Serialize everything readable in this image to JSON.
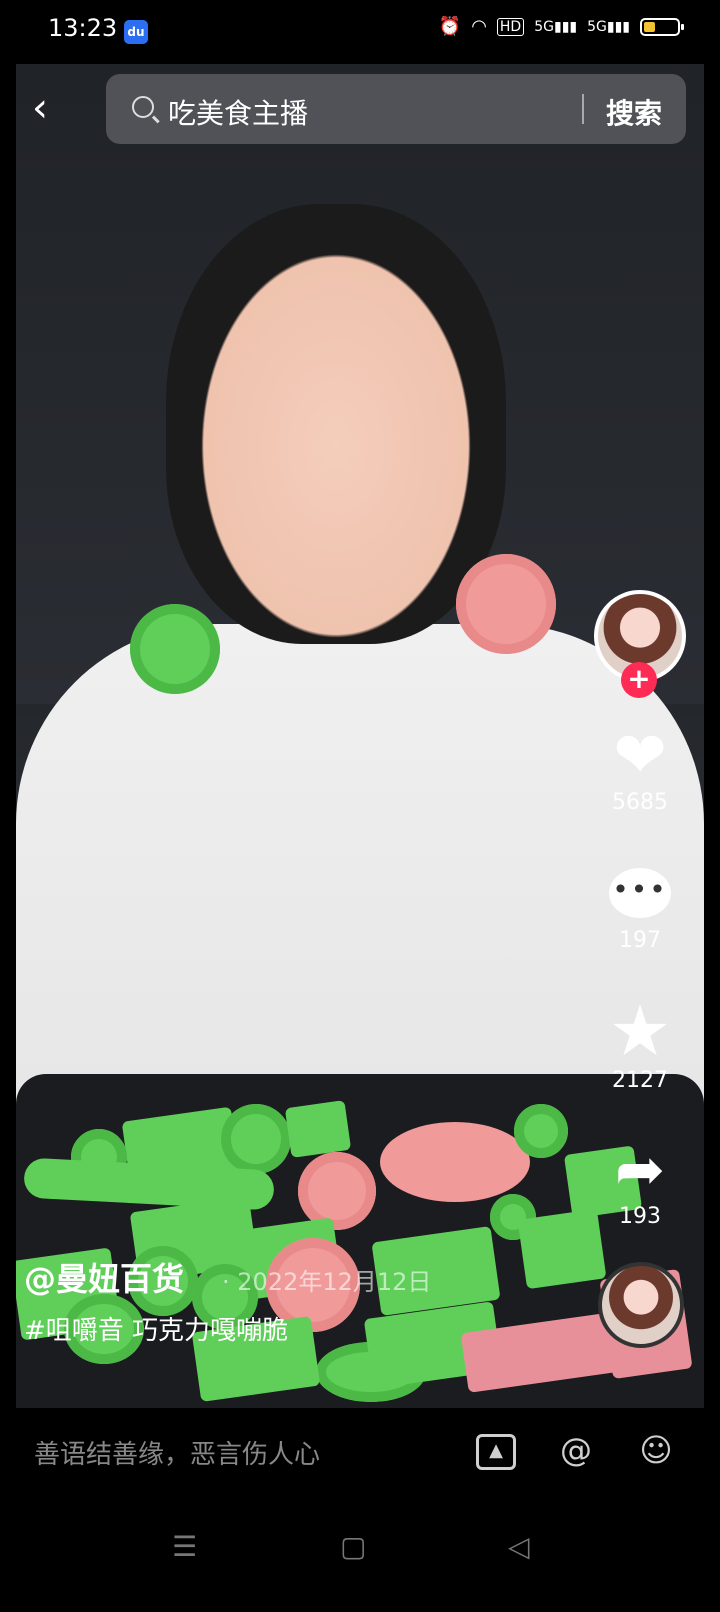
{
  "status_bar": {
    "time": "13:23",
    "app_badge": "du",
    "hd_label": "HD",
    "signal1": "5G",
    "signal2": "5G",
    "battery_level": 0.35
  },
  "search": {
    "query": "吃美食主播",
    "button_label": "搜索"
  },
  "rail": {
    "likes": "5685",
    "comments": "197",
    "favorites": "2127",
    "shares": "193"
  },
  "caption": {
    "author": "@曼妞百货",
    "date": "2022年12月12日",
    "description": "#咀嚼音 巧克力嘎嘣脆"
  },
  "comment_bar": {
    "placeholder": "善语结善缘，恶言伤人心"
  },
  "icons": {
    "back": "chevron-left-icon",
    "search": "search-icon",
    "like": "heart-icon",
    "comment": "comment-icon",
    "favorite": "star-icon",
    "share": "share-icon",
    "image": "image-icon",
    "mention": "at-icon",
    "emoji": "emoji-icon"
  },
  "colors": {
    "accent": "#fe2c55",
    "battery": "#f1c232"
  }
}
